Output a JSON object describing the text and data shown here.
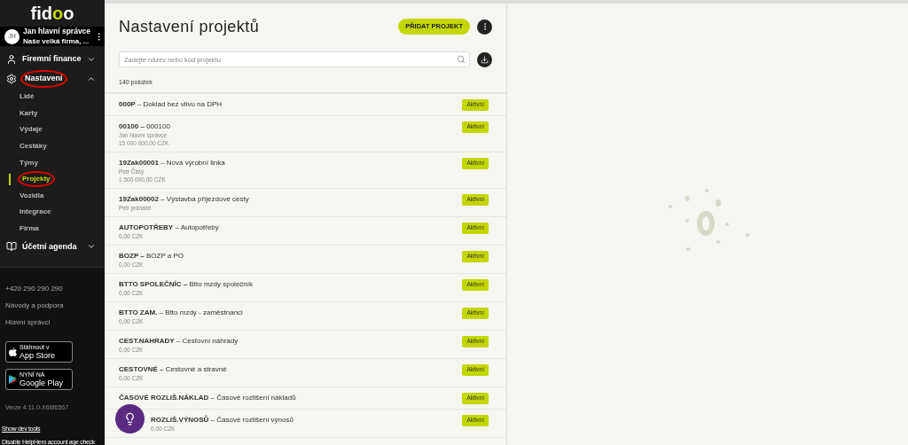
{
  "sidebar": {
    "logo": {
      "start": "fid",
      "accent": "o",
      "end": "o"
    },
    "user": {
      "initials": "JH",
      "name": "Jan hlavní správce",
      "company": "Naše velká firma, ..."
    },
    "nav": [
      {
        "label": "Firemní finance",
        "expanded": false,
        "highlighted": false
      },
      {
        "label": "Nastavení",
        "expanded": true,
        "highlighted": true,
        "children": [
          {
            "label": "Lidé",
            "selected": false,
            "highlighted": false
          },
          {
            "label": "Karty",
            "selected": false,
            "highlighted": false
          },
          {
            "label": "Výdaje",
            "selected": false,
            "highlighted": false
          },
          {
            "label": "Cestáky",
            "selected": false,
            "highlighted": false
          },
          {
            "label": "Týmy",
            "selected": false,
            "highlighted": false
          },
          {
            "label": "Projekty",
            "selected": true,
            "highlighted": true
          },
          {
            "label": "Vozidla",
            "selected": false,
            "highlighted": false
          },
          {
            "label": "Integrace",
            "selected": false,
            "highlighted": false
          },
          {
            "label": "Firma",
            "selected": false,
            "highlighted": false
          }
        ]
      },
      {
        "label": "Účetní agenda",
        "expanded": false,
        "highlighted": false
      }
    ],
    "links": [
      "+420 290 290 290",
      "Návody a podpora",
      "Hlavní správci"
    ],
    "stores": [
      {
        "kind": "apple",
        "small": "Stáhnout v",
        "big": "App Store"
      },
      {
        "kind": "google",
        "small": "NYNÍ NA",
        "big": "Google Play"
      }
    ],
    "version": "Verze 4.11.0-X66f6567",
    "dev_links": [
      "Show dev tools",
      "Disable HelpHero account age check"
    ]
  },
  "main": {
    "title": "Nastavení projektů",
    "add_button": "PŘIDAT PROJEKT",
    "search": {
      "placeholder": "Zadejte název nebo kód projektu"
    },
    "count": "140 položek",
    "rows": [
      {
        "title": "**000P** – Doklad bez vlivu na DPH",
        "status": "Aktivní",
        "behind_help_button": false
      },
      {
        "title": "**00100 –** 000100",
        "details": [
          "Jan hlavní správce",
          "15 000 000,00 CZK"
        ],
        "status": "Aktivní",
        "behind_help_button": false
      },
      {
        "title": "**19Zak00001** – Nová výrobní linka",
        "details": [
          "Petr Čistý",
          "1 500 000,00 CZK"
        ],
        "status": "Aktivní",
        "behind_help_button": false
      },
      {
        "title": "**19Zak00002** – Výstavba příjezdové cesty",
        "details": [
          "Petr jednatel"
        ],
        "status": "Aktivní",
        "behind_help_button": false
      },
      {
        "title": "**AUTOPOTŘEBY** – Autopotřeby",
        "details": [
          "0,00 CZK"
        ],
        "status": "Aktivní",
        "behind_help_button": false
      },
      {
        "title": "**BOZP –** BOZP a PO",
        "details": [
          "0,00 CZK"
        ],
        "status": "Aktivní",
        "behind_help_button": false
      },
      {
        "title": "**BTTO SPOLEČNÍC –** Btto mzdy společník",
        "details": [
          "0,00 CZK"
        ],
        "status": "Aktivní",
        "behind_help_button": false
      },
      {
        "title": "**BTTO ZAM.** – Btto mzdy - zaměstnanci",
        "details": [
          "0,00 CZK"
        ],
        "status": "Aktivní",
        "behind_help_button": false
      },
      {
        "title": "**CEST.NAHRADY** – Cestovní náhrady",
        "details": [
          "0,00 CZK"
        ],
        "status": "Aktivní",
        "behind_help_button": false
      },
      {
        "title": "**CESTOVNÉ –** Cestovné a stravné",
        "details": [
          "0,00 CZK"
        ],
        "status": "Aktivní",
        "behind_help_button": false
      },
      {
        "title": "**ČASOVÉ ROZLIŠ.NÁKLAD** – Časové rozlišení nákladů",
        "status": "Aktivní",
        "behind_help_button": false
      },
      {
        "title": "**ROZLIŠ.VÝNOSŮ** – Časové rozlišení výnosů",
        "details": [
          "0,00 CZK"
        ],
        "status": "Aktivní",
        "behind_help_button": true
      }
    ]
  }
}
